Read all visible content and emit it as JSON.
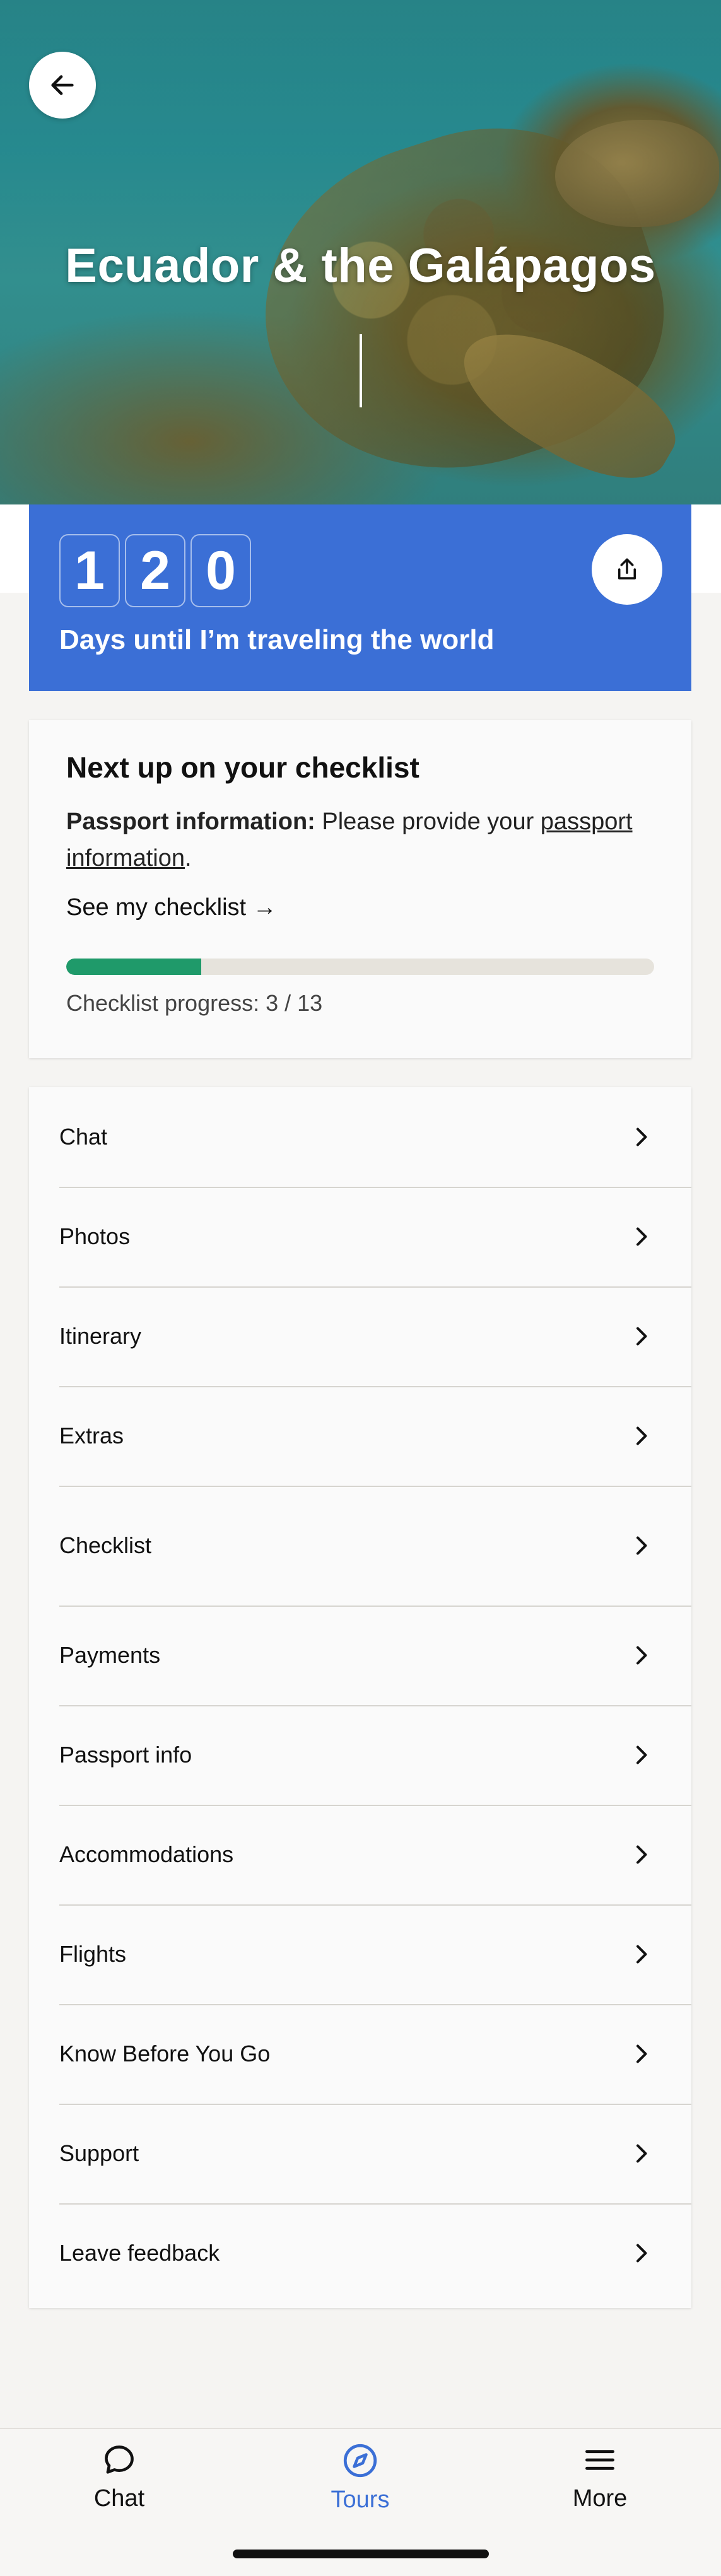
{
  "hero": {
    "title": "Ecuador & the Galápagos",
    "back_icon": "arrow-left-icon"
  },
  "countdown": {
    "digits": [
      "1",
      "2",
      "0"
    ],
    "label": "Days until I’m traveling the world",
    "share_icon": "share-icon",
    "background_color": "#3b6fd6"
  },
  "checklist_card": {
    "title": "Next up on your checklist",
    "item_bold": "Passport information:",
    "item_text": " Please provide your ",
    "item_link": "passport information",
    "item_end": ".",
    "see_link": "See my checklist →",
    "progress_label": "Checklist progress: 3 / 13",
    "progress_fraction": 0.23,
    "progress_color": "#1f9a6a"
  },
  "menu": {
    "items": [
      {
        "label": "Chat"
      },
      {
        "label": "Photos"
      },
      {
        "label": "Itinerary"
      },
      {
        "label": "Extras"
      },
      {
        "label": "Checklist"
      },
      {
        "label": "Payments"
      },
      {
        "label": "Passport info"
      },
      {
        "label": "Accommodations"
      },
      {
        "label": "Flights"
      },
      {
        "label": "Know Before You Go"
      },
      {
        "label": "Support"
      },
      {
        "label": "Leave feedback"
      }
    ],
    "chevron_icon": "chevron-right-icon"
  },
  "tabbar": {
    "tabs": [
      {
        "label": "Chat",
        "icon": "chat-bubble-icon",
        "active": false
      },
      {
        "label": "Tours",
        "icon": "compass-icon",
        "active": true
      },
      {
        "label": "More",
        "icon": "hamburger-menu-icon",
        "active": false
      }
    ],
    "active_color": "#3b6fd6"
  }
}
